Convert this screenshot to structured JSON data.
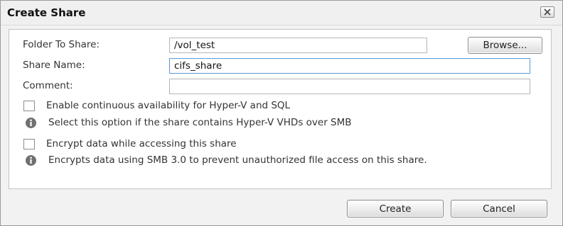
{
  "dialog": {
    "title": "Create Share",
    "close_icon": "close-icon"
  },
  "form": {
    "folder_label": "Folder To Share:",
    "folder_value": "/vol_test",
    "browse_label": "Browse...",
    "share_name_label": "Share Name:",
    "share_name_value": "cifs_share",
    "comment_label": "Comment:",
    "comment_value": ""
  },
  "options": {
    "continuous_availability": {
      "label": "Enable continuous availability for Hyper-V and SQL",
      "checked": false,
      "info_text": "Select this option if the share contains Hyper-V VHDs over SMB",
      "info_icon": "info-icon"
    },
    "encrypt": {
      "label": "Encrypt data while accessing this share",
      "checked": false,
      "info_text": "Encrypts data using SMB 3.0 to prevent unauthorized file access on this share.",
      "info_icon": "info-icon"
    }
  },
  "footer": {
    "create_label": "Create",
    "cancel_label": "Cancel"
  },
  "colors": {
    "focus_border": "#5a9bd5",
    "info_icon": "#707070"
  }
}
